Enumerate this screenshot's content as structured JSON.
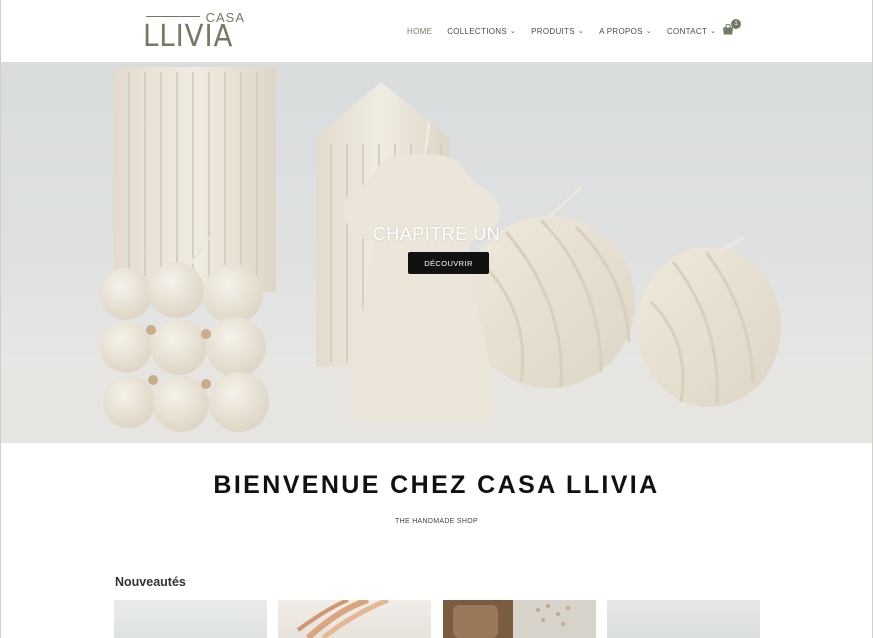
{
  "brand": {
    "casa": "CASA",
    "name": "LLIVIA",
    "color": "#6f7c63"
  },
  "nav": {
    "items": [
      {
        "label": "HOME",
        "has_dropdown": false
      },
      {
        "label": "COLLECTIONS",
        "has_dropdown": true
      },
      {
        "label": "PRODUITS",
        "has_dropdown": true
      },
      {
        "label": "A PROPOS",
        "has_dropdown": true
      },
      {
        "label": "CONTACT",
        "has_dropdown": true
      }
    ],
    "dropdown_glyph": "⌄",
    "cart_count": "1",
    "cart_icon": "shopping-bag-icon"
  },
  "hero": {
    "title": "CHAPITRE UN",
    "button_label": "DÉCOUVRIR"
  },
  "welcome": {
    "title": "BIENVENUE CHEZ CASA LLIVIA",
    "subtitle": "THE HANDMADE SHOP"
  },
  "new_section": {
    "title": "Nouveautés"
  },
  "colors": {
    "accent": "#6f7c63",
    "button_bg": "#111111",
    "hero_bg": "#dcdfe0"
  }
}
